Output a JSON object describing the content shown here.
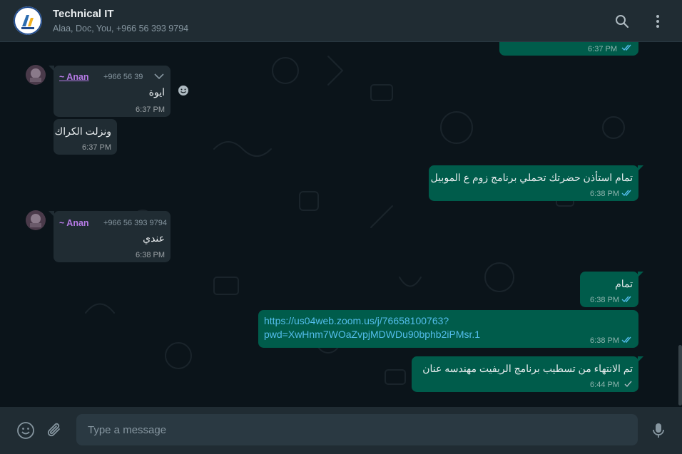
{
  "header": {
    "title": "Technical IT",
    "members": "Alaa, Doc, You, +966 56 393 9794",
    "search_icon": "search-icon",
    "menu_icon": "more-vertical-icon"
  },
  "messages": {
    "m0": {
      "time": "6:37 PM",
      "status": "read"
    },
    "m1": {
      "sender": "~ Anan",
      "phone": "+966 56 39",
      "text": "ايوة",
      "time": "6:37 PM"
    },
    "m2": {
      "text": "ونزلت الكراك",
      "time": "6:37 PM"
    },
    "m3": {
      "text": "تمام استأذن حضرتك تحملي برنامج زوم ع الموبيل",
      "time": "6:38 PM",
      "status": "read"
    },
    "m4": {
      "sender": "~ Anan",
      "phone": "+966 56 393 9794",
      "text": "عندي",
      "time": "6:38 PM"
    },
    "m5": {
      "text": "تمام",
      "time": "6:38 PM",
      "status": "read"
    },
    "m6": {
      "link_line1": "https://us04web.zoom.us/j/76658100763?",
      "link_line2": "pwd=XwHnm7WOaZvpjMDWDu90bphb2iPMsr.1",
      "time": "6:38 PM",
      "status": "read"
    },
    "m7": {
      "text": "تم الانتهاء  من تسطيب  برنامج الريفيت مهندسه عنان",
      "time": "6:44 PM",
      "status": "sent"
    }
  },
  "composer": {
    "placeholder": "Type a message"
  },
  "colors": {
    "outgoing": "#005c4b",
    "incoming": "#202c33",
    "background": "#0b141a",
    "read_tick": "#53bdeb",
    "sender_name": "#b67be6"
  }
}
